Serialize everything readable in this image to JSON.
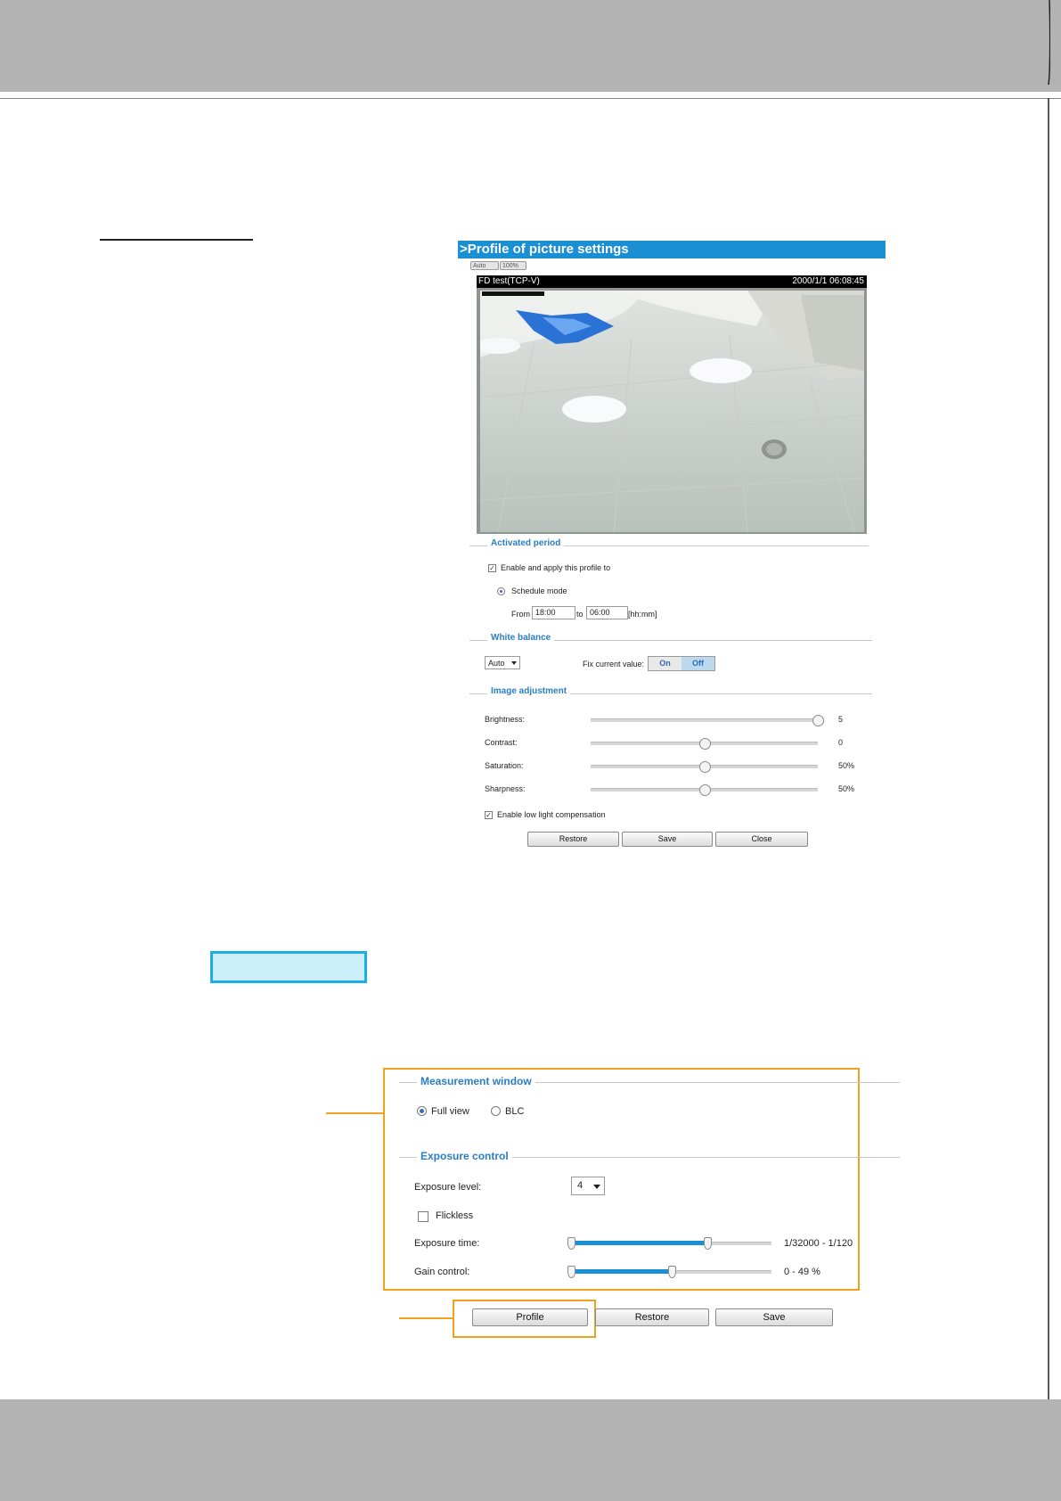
{
  "profile_panel": {
    "title": ">Profile of picture settings",
    "toolbar": {
      "auto": "Auto",
      "zoom": "100%"
    },
    "video": {
      "camera_label": "FD test(TCP-V)",
      "timestamp": "2000/1/1 06:08:45"
    },
    "activated_period": {
      "legend": "Activated period",
      "enable_label": "Enable and apply this profile to",
      "enable_checked": true,
      "schedule_label": "Schedule mode",
      "from_label": "From",
      "from_value": "18:00",
      "to_label": "to",
      "to_value": "06:00",
      "format_hint": "[hh:mm]"
    },
    "white_balance": {
      "legend": "White balance",
      "mode_value": "Auto",
      "fix_label": "Fix current value:",
      "on_label": "On",
      "off_label": "Off"
    },
    "image_adjustment": {
      "legend": "Image adjustment",
      "rows": [
        {
          "label": "Brightness:",
          "value": "5",
          "position": 1.0
        },
        {
          "label": "Contrast:",
          "value": "0",
          "position": 0.5
        },
        {
          "label": "Saturation:",
          "value": "50%",
          "position": 0.5
        },
        {
          "label": "Sharpness:",
          "value": "50%",
          "position": 0.5
        }
      ],
      "low_light_label": "Enable low light compensation",
      "low_light_checked": true
    },
    "buttons": {
      "restore": "Restore",
      "save": "Save",
      "close": "Close"
    }
  },
  "measurement": {
    "legend": "Measurement window",
    "full_view_label": "Full view",
    "blc_label": "BLC",
    "selected": "Full view"
  },
  "exposure": {
    "legend": "Exposure control",
    "level_label": "Exposure level:",
    "level_value": "4",
    "flickless_label": "Flickless",
    "flickless_checked": false,
    "time_label": "Exposure time:",
    "time_value": "1/32000 - 1/120",
    "time_range_fraction": [
      0.0,
      0.68
    ],
    "gain_label": "Gain control:",
    "gain_value": "0 - 49 %",
    "gain_range_fraction": [
      0.0,
      0.5
    ]
  },
  "bottom_buttons": {
    "profile": "Profile",
    "restore": "Restore",
    "save": "Save"
  },
  "colors": {
    "accent_blue": "#1a8fd3",
    "highlight_orange": "#f0a11f",
    "highlight_cyan": "#1ab0e6"
  }
}
